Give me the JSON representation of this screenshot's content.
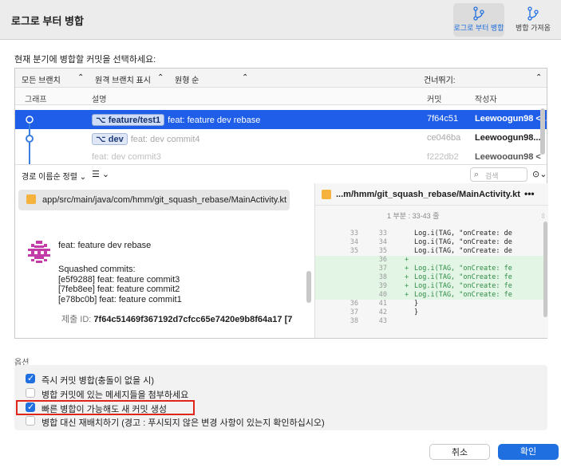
{
  "window": {
    "title": "로그로 부터 병합"
  },
  "toolbar": {
    "merge_from_log": "로그로 부터 병합",
    "merge_fetched": "병합 가져옴"
  },
  "heading": "현재 분기에 병합할 커밋을 선택하세요:",
  "filters": {
    "all_branches": "모든 브랜치",
    "show_remote": "원격 브랜치 표시",
    "order": "원형 순",
    "skip": "건너뛰기:"
  },
  "columns": {
    "graph": "그래프",
    "description": "설명",
    "commit": "커밋",
    "author": "작성자"
  },
  "commits": [
    {
      "tag": "feature/test1",
      "message": "feat: feature dev rebase",
      "hash": "7f64c51",
      "author": "Leewoogun98 <..."
    },
    {
      "tag": "dev",
      "message": "feat: dev commit4",
      "hash": "ce046ba",
      "author": "Leewoogun98..."
    },
    {
      "tag": "",
      "message": "feat: dev commit3",
      "hash": "f222db2",
      "author": "Leewoogun98 <"
    }
  ],
  "sortbar": {
    "sort": "경로 이름순 정렬 ⌄",
    "view": "☰ ⌄",
    "search_placeholder": "검색",
    "more": "⊙⌄"
  },
  "file": {
    "path": "app/src/main/java/com/hmm/git_squash_rebase/MainActivity.kt"
  },
  "message": {
    "title": "feat: feature dev rebase",
    "body": [
      "Squashed commits:",
      "[e5f9288] feat: feature commit3",
      "[7feb8ee] feat: feature commit2",
      "[e78bc0b] feat: feature commit1"
    ],
    "commit_id_label": "제출 ID:",
    "commit_id": "7f64c51469f367192d7cfcc65e7420e9b8f64a17 [7"
  },
  "diff": {
    "file": "...m/hmm/git_squash_rebase/MainActivity.kt",
    "more": "•••",
    "hunk": "1 부분 : 33-43 줄",
    "lines": [
      {
        "n1": "33",
        "n2": "33",
        "mark": "",
        "text": "Log.i(TAG, \"onCreate: de",
        "add": false
      },
      {
        "n1": "34",
        "n2": "34",
        "mark": "",
        "text": "Log.i(TAG, \"onCreate: de",
        "add": false
      },
      {
        "n1": "35",
        "n2": "35",
        "mark": "",
        "text": "Log.i(TAG, \"onCreate: de",
        "add": false
      },
      {
        "n1": "",
        "n2": "36",
        "mark": "+",
        "text": "",
        "add": true
      },
      {
        "n1": "",
        "n2": "37",
        "mark": "+",
        "text": "Log.i(TAG, \"onCreate: fe",
        "add": true
      },
      {
        "n1": "",
        "n2": "38",
        "mark": "+",
        "text": "Log.i(TAG, \"onCreate: fe",
        "add": true
      },
      {
        "n1": "",
        "n2": "39",
        "mark": "+",
        "text": "Log.i(TAG, \"onCreate: fe",
        "add": true
      },
      {
        "n1": "",
        "n2": "40",
        "mark": "+",
        "text": "Log.i(TAG, \"onCreate: fe",
        "add": true
      },
      {
        "n1": "36",
        "n2": "41",
        "mark": "",
        "text": "}",
        "add": false
      },
      {
        "n1": "37",
        "n2": "42",
        "mark": "",
        "text": "}",
        "add": false
      },
      {
        "n1": "38",
        "n2": "43",
        "mark": "",
        "text": "",
        "add": false
      }
    ]
  },
  "options": {
    "label": "옵션",
    "items": [
      {
        "text": "즉시 커밋 병합(충돌이 없을 시)",
        "checked": true
      },
      {
        "text": "병합 커밋에 있는 메세지들을 첨부하세요",
        "checked": false
      },
      {
        "text": "빠른 병합이 가능해도 새 커밋 생성",
        "checked": true
      },
      {
        "text": "병합 대신 재배치하기 (경고 : 푸시되지 않은 변경 사항이 있는지 확인하십시오)",
        "checked": false
      }
    ]
  },
  "buttons": {
    "cancel": "취소",
    "ok": "확인"
  },
  "colors": {
    "accent": "#1f6fe0",
    "selection": "#1f5ee8",
    "highlight_border": "#e0251b"
  }
}
